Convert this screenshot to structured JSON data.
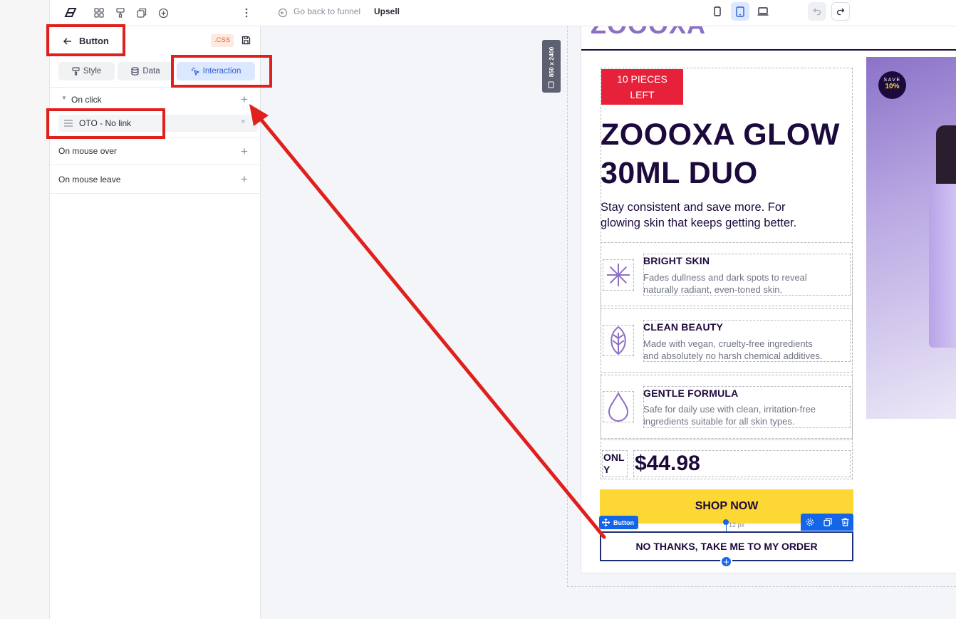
{
  "topbar": {
    "back_label": "Go back to funnel",
    "page_name": "Upsell"
  },
  "panel": {
    "title": "Button",
    "css_badge": ".CSS",
    "tabs": [
      "Style",
      "Data",
      "Interaction"
    ],
    "active_tab": "Interaction",
    "events": {
      "on_click": "On click",
      "action": "OTO - No link",
      "on_mouse_over": "On mouse over",
      "on_mouse_leave": "On mouse leave"
    }
  },
  "canvas": {
    "size_badge": "850 x 2400",
    "header_logo": "ZOOOXA",
    "stock_badge_line1": "10 PIECES",
    "stock_badge_line2": "LEFT",
    "product_title_line1": "ZOOOXA GLOW",
    "product_title_line2": "30ML DUO",
    "subtitle_line1": "Stay consistent and save more. For",
    "subtitle_line2": "glowing skin that keeps getting better.",
    "features": [
      {
        "icon": "asterisk-icon",
        "title": "BRIGHT SKIN",
        "desc_line1": "Fades dullness and dark spots to reveal",
        "desc_line2": "naturally radiant, even-toned skin."
      },
      {
        "icon": "leaf-icon",
        "title": "CLEAN BEAUTY",
        "desc_line1": "Made with vegan, cruelty-free ingredients",
        "desc_line2": "and absolutely no harsh chemical additives."
      },
      {
        "icon": "drop-icon",
        "title": "GENTLE FORMULA",
        "desc_line1": "Safe for daily use with clean, irritation-free",
        "desc_line2": "ingredients suitable for all skin types."
      }
    ],
    "price_prefix_line1": "ONL",
    "price_prefix_line2": "Y",
    "price": "$44.98",
    "shop_button": "SHOP NOW",
    "selected_tag": "Button",
    "spacing_label": "12 px",
    "decline_button": "NO THANKS, TAKE ME TO MY ORDER",
    "save_badge_line1": "SAVE",
    "save_badge_line2": "10%"
  },
  "colors": {
    "accent_red": "#e0201c",
    "brand_purple": "#1d0a3c",
    "shop_yellow": "#fdd835",
    "select_blue": "#1565e8",
    "badge_red": "#e8213a"
  }
}
